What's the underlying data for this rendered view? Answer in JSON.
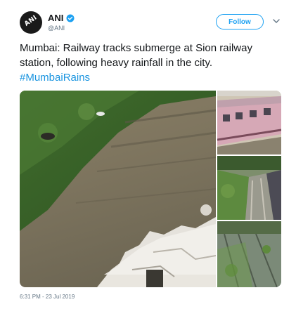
{
  "account": {
    "display_name": "ANI",
    "handle": "@ANI",
    "avatar_label": "ANI",
    "verified": true
  },
  "follow_label": "Follow",
  "tweet": {
    "text_before": "Mumbai: Railway tracks submerge at Sion railway station, following heavy rainfall in the city. ",
    "hashtag": "#MumbaiRains"
  },
  "media": {
    "photo_count": 4
  },
  "timestamp": "6:31 PM - 23 Jul 2019",
  "colors": {
    "accent": "#1da1f2",
    "hashtag": "#1b95e0",
    "text": "#14171a",
    "muted": "#657786"
  },
  "icons": {
    "verified": "verified-badge-icon",
    "menu": "chevron-down-icon"
  }
}
